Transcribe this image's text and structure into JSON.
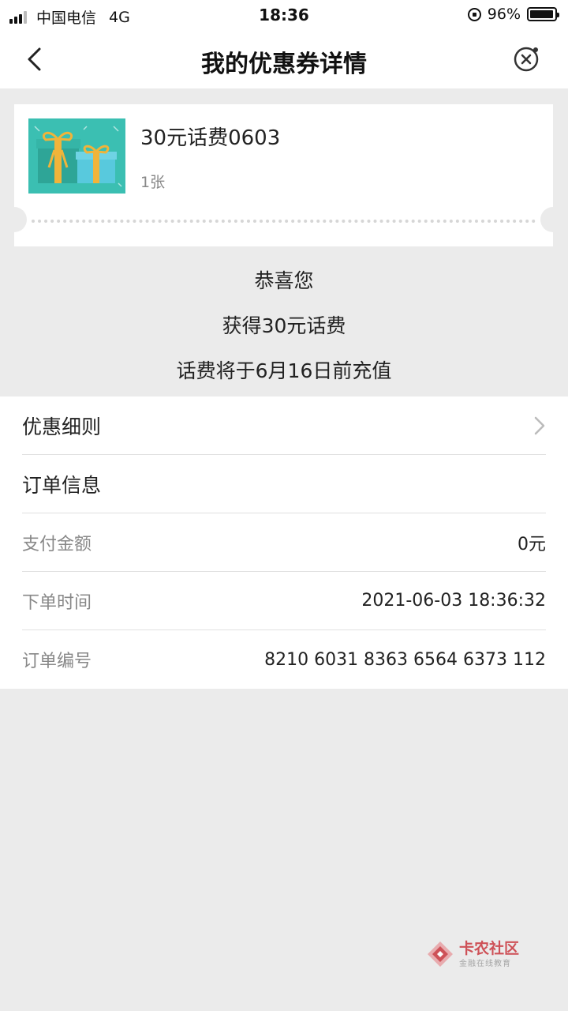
{
  "status_bar": {
    "carrier": "中国电信",
    "network": "4G",
    "time": "18:36",
    "battery": "96%",
    "battery_level": 0.96
  },
  "nav": {
    "title": "我的优惠券详情"
  },
  "coupon": {
    "name": "30元话费0603",
    "count": "1张"
  },
  "message": {
    "line1": "恭喜您",
    "line2": "获得30元话费",
    "line3": "话费将于6月16日前充值"
  },
  "details": {
    "rules_label": "优惠细则",
    "order_info_label": "订单信息",
    "pay_amount_label": "支付金额",
    "pay_amount_value": "0元",
    "order_time_label": "下单时间",
    "order_time_value": "2021-06-03 18:36:32",
    "order_no_label": "订单编号",
    "order_no_value": "8210 6031 8363 6564 6373 112"
  },
  "watermark": {
    "title": "卡农社区",
    "subtitle": "金融在线教育"
  },
  "colors": {
    "background": "#ebebeb",
    "gift_bg": "#3bbfb2",
    "ribbon": "#f0b43a",
    "watermark_red": "#c9373e"
  }
}
